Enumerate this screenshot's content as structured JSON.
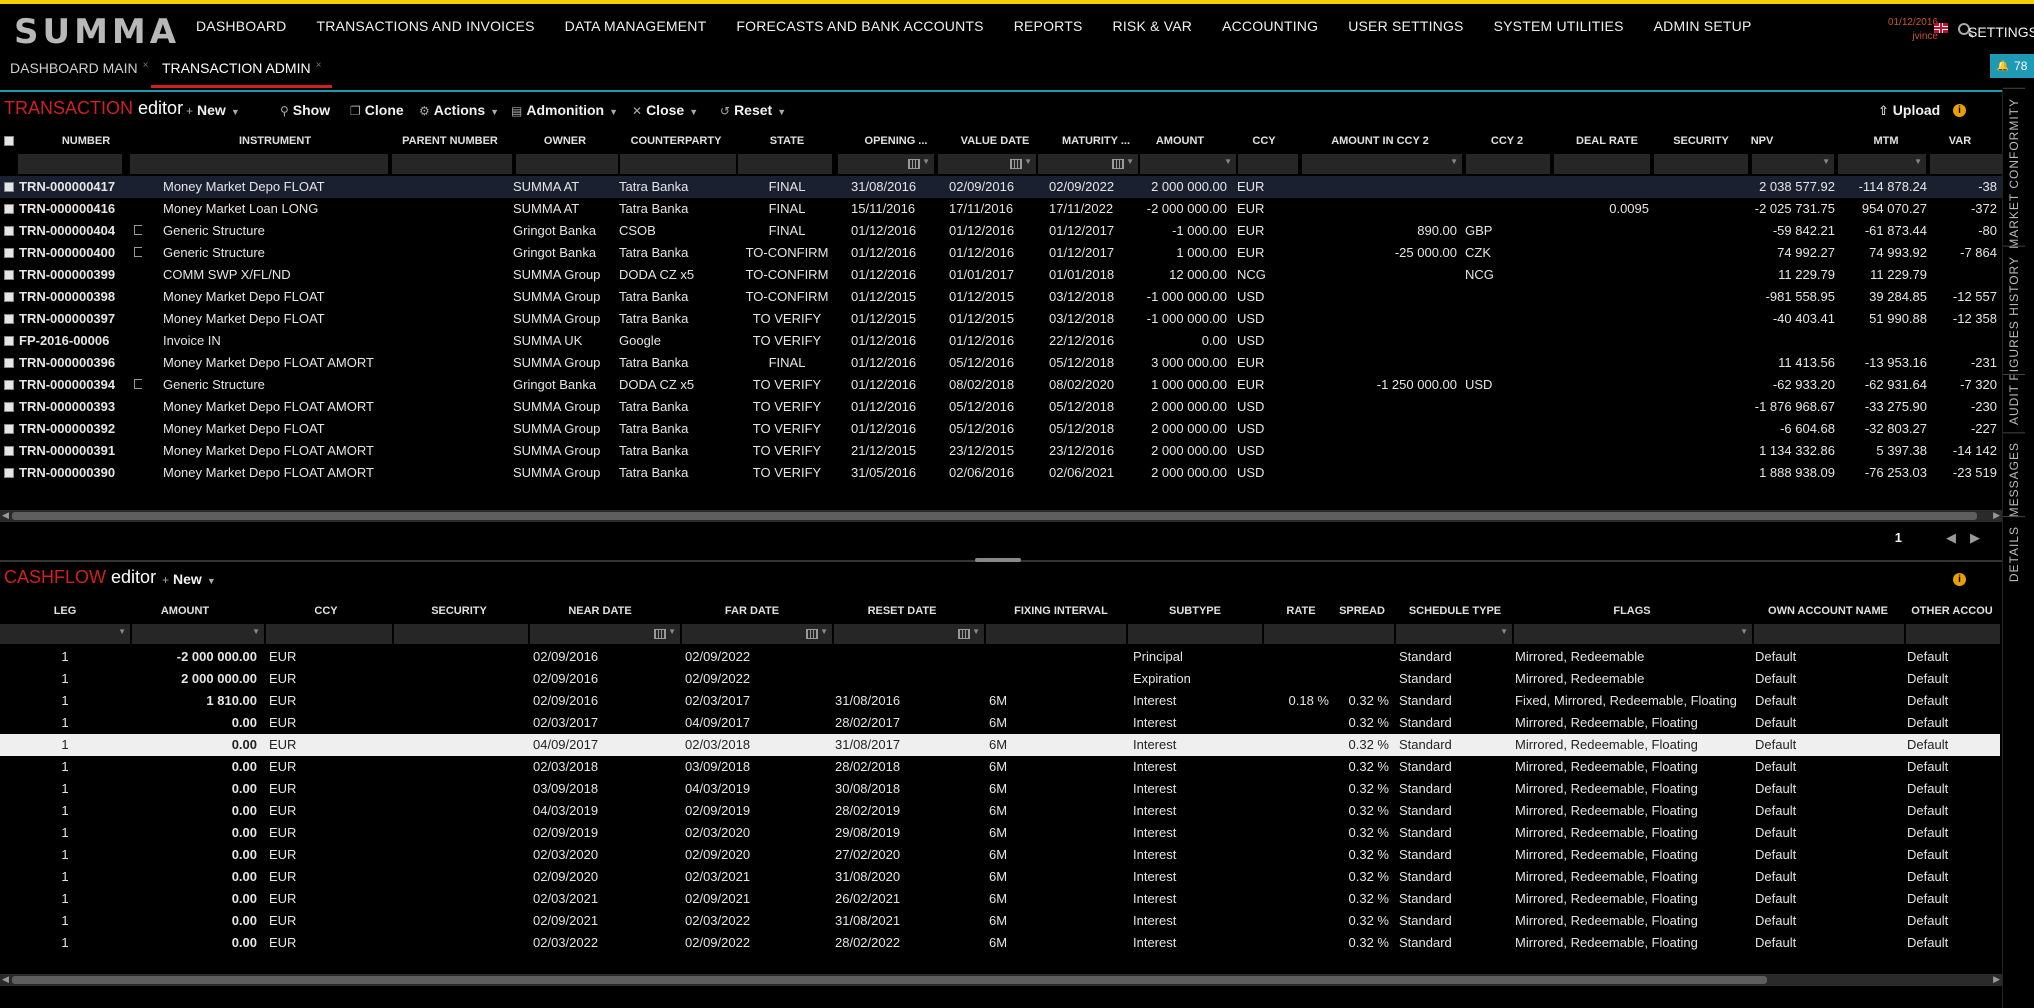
{
  "brand": "SUMMA",
  "nav": [
    "DASHBOARD",
    "TRANSACTIONS AND INVOICES",
    "DATA MANAGEMENT",
    "FORECASTS AND BANK ACCOUNTS",
    "REPORTS",
    "RISK & VAR",
    "ACCOUNTING",
    "USER SETTINGS",
    "SYSTEM UTILITIES",
    "ADMIN SETUP"
  ],
  "user": {
    "date": "01/12/2016",
    "name": "jvince"
  },
  "settings_label": "SETTINGS",
  "tabs": [
    {
      "label": "DASHBOARD MAIN"
    },
    {
      "label": "TRANSACTION ADMIN"
    }
  ],
  "notifications": "78",
  "transaction_editor": {
    "title_red": "TRANSACTION",
    "title_white": "editor",
    "toolbar": {
      "new": "New",
      "show": "Show",
      "clone": "Clone",
      "actions": "Actions",
      "admonition": "Admonition",
      "close": "Close",
      "reset": "Reset",
      "upload": "Upload"
    },
    "columns": [
      "NUMBER",
      "INSTRUMENT",
      "PARENT NUMBER",
      "OWNER",
      "COUNTERPARTY",
      "STATE",
      "OPENING ...",
      "VALUE DATE",
      "MATURITY ...",
      "AMOUNT",
      "CCY",
      "AMOUNT IN CCY 2",
      "CCY 2",
      "DEAL RATE",
      "SECURITY",
      "NPV",
      "MTM",
      "VAR"
    ],
    "rows": [
      {
        "number": "TRN-000000417",
        "instrument": "Money Market Depo FLOAT",
        "parent": "",
        "owner": "SUMMA AT",
        "counterparty": "Tatra Banka",
        "state": "FINAL",
        "opening": "31/08/2016",
        "value_date": "02/09/2016",
        "maturity": "02/09/2022",
        "amount": "2 000 000.00",
        "ccy": "EUR",
        "amount_ccy2": "",
        "ccy2": "",
        "deal_rate": "",
        "security": "",
        "npv": "2 038 577.92",
        "mtm": "-114 878.24",
        "var": "-38"
      },
      {
        "number": "TRN-000000416",
        "instrument": "Money Market Loan LONG",
        "parent": "",
        "owner": "SUMMA AT",
        "counterparty": "Tatra Banka",
        "state": "FINAL",
        "opening": "15/11/2016",
        "value_date": "17/11/2016",
        "maturity": "17/11/2022",
        "amount": "-2 000 000.00",
        "ccy": "EUR",
        "amount_ccy2": "",
        "ccy2": "",
        "deal_rate": "0.0095",
        "security": "",
        "npv": "-2 025 731.75",
        "mtm": "954 070.27",
        "var": "-372"
      },
      {
        "number": "TRN-000000404",
        "instrument": "Generic Structure",
        "parent": "",
        "owner": "Gringot Banka",
        "counterparty": "CSOB",
        "state": "FINAL",
        "opening": "01/12/2016",
        "value_date": "01/12/2016",
        "maturity": "01/12/2017",
        "amount": "-1 000.00",
        "ccy": "EUR",
        "amount_ccy2": "890.00",
        "ccy2": "GBP",
        "deal_rate": "",
        "security": "",
        "npv": "-59 842.21",
        "mtm": "-61 873.44",
        "var": "-80"
      },
      {
        "number": "TRN-000000400",
        "instrument": "Generic Structure",
        "parent": "",
        "owner": "Gringot Banka",
        "counterparty": "Tatra Banka",
        "state": "TO-CONFIRM",
        "opening": "01/12/2016",
        "value_date": "01/12/2016",
        "maturity": "01/12/2017",
        "amount": "1 000.00",
        "ccy": "EUR",
        "amount_ccy2": "-25 000.00",
        "ccy2": "CZK",
        "deal_rate": "",
        "security": "",
        "npv": "74 992.27",
        "mtm": "74 993.92",
        "var": "-7 864"
      },
      {
        "number": "TRN-000000399",
        "instrument": "COMM SWP X/FL/ND",
        "parent": "",
        "owner": "SUMMA Group",
        "counterparty": "DODA CZ x5",
        "state": "TO-CONFIRM",
        "opening": "01/12/2016",
        "value_date": "01/01/2017",
        "maturity": "01/01/2018",
        "amount": "12 000.00",
        "ccy": "NCG",
        "amount_ccy2": "",
        "ccy2": "NCG",
        "deal_rate": "",
        "security": "",
        "npv": "11 229.79",
        "mtm": "11 229.79",
        "var": ""
      },
      {
        "number": "TRN-000000398",
        "instrument": "Money Market Depo FLOAT",
        "parent": "",
        "owner": "SUMMA Group",
        "counterparty": "Tatra Banka",
        "state": "TO-CONFIRM",
        "opening": "01/12/2015",
        "value_date": "01/12/2015",
        "maturity": "03/12/2018",
        "amount": "-1 000 000.00",
        "ccy": "USD",
        "amount_ccy2": "",
        "ccy2": "",
        "deal_rate": "",
        "security": "",
        "npv": "-981 558.95",
        "mtm": "39 284.85",
        "var": "-12 557"
      },
      {
        "number": "TRN-000000397",
        "instrument": "Money Market Depo FLOAT",
        "parent": "",
        "owner": "SUMMA Group",
        "counterparty": "Tatra Banka",
        "state": "TO VERIFY",
        "opening": "01/12/2015",
        "value_date": "01/12/2015",
        "maturity": "03/12/2018",
        "amount": "-1 000 000.00",
        "ccy": "USD",
        "amount_ccy2": "",
        "ccy2": "",
        "deal_rate": "",
        "security": "",
        "npv": "-40 403.41",
        "mtm": "51 990.88",
        "var": "-12 358"
      },
      {
        "number": "FP-2016-00006",
        "instrument": "Invoice IN",
        "parent": "",
        "owner": "SUMMA UK",
        "counterparty": "Google",
        "state": "TO VERIFY",
        "opening": "01/12/2016",
        "value_date": "01/12/2016",
        "maturity": "22/12/2016",
        "amount": "0.00",
        "ccy": "USD",
        "amount_ccy2": "",
        "ccy2": "",
        "deal_rate": "",
        "security": "",
        "npv": "",
        "mtm": "",
        "var": ""
      },
      {
        "number": "TRN-000000396",
        "instrument": "Money Market Depo FLOAT AMORT",
        "parent": "",
        "owner": "SUMMA Group",
        "counterparty": "Tatra Banka",
        "state": "FINAL",
        "opening": "01/12/2016",
        "value_date": "05/12/2016",
        "maturity": "05/12/2018",
        "amount": "3 000 000.00",
        "ccy": "EUR",
        "amount_ccy2": "",
        "ccy2": "",
        "deal_rate": "",
        "security": "",
        "npv": "11 413.56",
        "mtm": "-13 953.16",
        "var": "-231"
      },
      {
        "number": "TRN-000000394",
        "instrument": "Generic Structure",
        "parent": "",
        "owner": "Gringot Banka",
        "counterparty": "DODA CZ x5",
        "state": "TO VERIFY",
        "opening": "01/12/2016",
        "value_date": "08/02/2018",
        "maturity": "08/02/2020",
        "amount": "1 000 000.00",
        "ccy": "EUR",
        "amount_ccy2": "-1 250 000.00",
        "ccy2": "USD",
        "deal_rate": "",
        "security": "",
        "npv": "-62 933.20",
        "mtm": "-62 931.64",
        "var": "-7 320"
      },
      {
        "number": "TRN-000000393",
        "instrument": "Money Market Depo FLOAT AMORT",
        "parent": "",
        "owner": "SUMMA Group",
        "counterparty": "Tatra Banka",
        "state": "TO VERIFY",
        "opening": "01/12/2016",
        "value_date": "05/12/2016",
        "maturity": "05/12/2018",
        "amount": "2 000 000.00",
        "ccy": "USD",
        "amount_ccy2": "",
        "ccy2": "",
        "deal_rate": "",
        "security": "",
        "npv": "-1 876 968.67",
        "mtm": "-33 275.90",
        "var": "-230"
      },
      {
        "number": "TRN-000000392",
        "instrument": "Money Market Depo FLOAT",
        "parent": "",
        "owner": "SUMMA Group",
        "counterparty": "Tatra Banka",
        "state": "TO VERIFY",
        "opening": "01/12/2016",
        "value_date": "05/12/2016",
        "maturity": "05/12/2018",
        "amount": "2 000 000.00",
        "ccy": "USD",
        "amount_ccy2": "",
        "ccy2": "",
        "deal_rate": "",
        "security": "",
        "npv": "-6 604.68",
        "mtm": "-32 803.27",
        "var": "-227"
      },
      {
        "number": "TRN-000000391",
        "instrument": "Money Market Depo FLOAT AMORT",
        "parent": "",
        "owner": "SUMMA Group",
        "counterparty": "Tatra Banka",
        "state": "TO VERIFY",
        "opening": "21/12/2015",
        "value_date": "23/12/2015",
        "maturity": "23/12/2016",
        "amount": "2 000 000.00",
        "ccy": "USD",
        "amount_ccy2": "",
        "ccy2": "",
        "deal_rate": "",
        "security": "",
        "npv": "1 134 332.86",
        "mtm": "5 397.38",
        "var": "-14 142"
      },
      {
        "number": "TRN-000000390",
        "instrument": "Money Market Depo FLOAT AMORT",
        "parent": "",
        "owner": "SUMMA Group",
        "counterparty": "Tatra Banka",
        "state": "TO VERIFY",
        "opening": "31/05/2016",
        "value_date": "02/06/2016",
        "maturity": "02/06/2021",
        "amount": "2 000 000.00",
        "ccy": "USD",
        "amount_ccy2": "",
        "ccy2": "",
        "deal_rate": "",
        "security": "",
        "npv": "1 888 938.09",
        "mtm": "-76 253.03",
        "var": "-23 519"
      }
    ],
    "page": "1"
  },
  "cashflow_editor": {
    "title_red": "CASHFLOW",
    "title_white": "editor",
    "toolbar": {
      "new": "New"
    },
    "columns": [
      "LEG",
      "AMOUNT",
      "CCY",
      "SECURITY",
      "NEAR DATE",
      "FAR DATE",
      "RESET DATE",
      "FIXING INTERVAL",
      "SUBTYPE",
      "RATE",
      "SPREAD",
      "SCHEDULE TYPE",
      "FLAGS",
      "OWN ACCOUNT NAME",
      "OTHER ACCOU"
    ],
    "rows": [
      {
        "leg": "1",
        "amount": "-2 000 000.00",
        "ccy": "EUR",
        "security": "",
        "near": "02/09/2016",
        "far": "02/09/2022",
        "reset": "",
        "fixing": "",
        "subtype": "Principal",
        "rate": "",
        "spread": "",
        "schedule": "Standard",
        "flags": "Mirrored, Redeemable",
        "own": "Default",
        "other": "Default"
      },
      {
        "leg": "1",
        "amount": "2 000 000.00",
        "ccy": "EUR",
        "security": "",
        "near": "02/09/2016",
        "far": "02/09/2022",
        "reset": "",
        "fixing": "",
        "subtype": "Expiration",
        "rate": "",
        "spread": "",
        "schedule": "Standard",
        "flags": "Mirrored, Redeemable",
        "own": "Default",
        "other": "Default"
      },
      {
        "leg": "1",
        "amount": "1 810.00",
        "ccy": "EUR",
        "security": "",
        "near": "02/09/2016",
        "far": "02/03/2017",
        "reset": "31/08/2016",
        "fixing": "6M",
        "subtype": "Interest",
        "rate": "0.18 %",
        "spread": "0.32 %",
        "schedule": "Standard",
        "flags": "Fixed, Mirrored, Redeemable, Floating",
        "own": "Default",
        "other": "Default"
      },
      {
        "leg": "1",
        "amount": "0.00",
        "ccy": "EUR",
        "security": "",
        "near": "02/03/2017",
        "far": "04/09/2017",
        "reset": "28/02/2017",
        "fixing": "6M",
        "subtype": "Interest",
        "rate": "",
        "spread": "0.32 %",
        "schedule": "Standard",
        "flags": "Mirrored, Redeemable, Floating",
        "own": "Default",
        "other": "Default"
      },
      {
        "leg": "1",
        "amount": "0.00",
        "ccy": "EUR",
        "security": "",
        "near": "04/09/2017",
        "far": "02/03/2018",
        "reset": "31/08/2017",
        "fixing": "6M",
        "subtype": "Interest",
        "rate": "",
        "spread": "0.32 %",
        "schedule": "Standard",
        "flags": "Mirrored, Redeemable, Floating",
        "own": "Default",
        "other": "Default"
      },
      {
        "leg": "1",
        "amount": "0.00",
        "ccy": "EUR",
        "security": "",
        "near": "02/03/2018",
        "far": "03/09/2018",
        "reset": "28/02/2018",
        "fixing": "6M",
        "subtype": "Interest",
        "rate": "",
        "spread": "0.32 %",
        "schedule": "Standard",
        "flags": "Mirrored, Redeemable, Floating",
        "own": "Default",
        "other": "Default"
      },
      {
        "leg": "1",
        "amount": "0.00",
        "ccy": "EUR",
        "security": "",
        "near": "03/09/2018",
        "far": "04/03/2019",
        "reset": "30/08/2018",
        "fixing": "6M",
        "subtype": "Interest",
        "rate": "",
        "spread": "0.32 %",
        "schedule": "Standard",
        "flags": "Mirrored, Redeemable, Floating",
        "own": "Default",
        "other": "Default"
      },
      {
        "leg": "1",
        "amount": "0.00",
        "ccy": "EUR",
        "security": "",
        "near": "04/03/2019",
        "far": "02/09/2019",
        "reset": "28/02/2019",
        "fixing": "6M",
        "subtype": "Interest",
        "rate": "",
        "spread": "0.32 %",
        "schedule": "Standard",
        "flags": "Mirrored, Redeemable, Floating",
        "own": "Default",
        "other": "Default"
      },
      {
        "leg": "1",
        "amount": "0.00",
        "ccy": "EUR",
        "security": "",
        "near": "02/09/2019",
        "far": "02/03/2020",
        "reset": "29/08/2019",
        "fixing": "6M",
        "subtype": "Interest",
        "rate": "",
        "spread": "0.32 %",
        "schedule": "Standard",
        "flags": "Mirrored, Redeemable, Floating",
        "own": "Default",
        "other": "Default"
      },
      {
        "leg": "1",
        "amount": "0.00",
        "ccy": "EUR",
        "security": "",
        "near": "02/03/2020",
        "far": "02/09/2020",
        "reset": "27/02/2020",
        "fixing": "6M",
        "subtype": "Interest",
        "rate": "",
        "spread": "0.32 %",
        "schedule": "Standard",
        "flags": "Mirrored, Redeemable, Floating",
        "own": "Default",
        "other": "Default"
      },
      {
        "leg": "1",
        "amount": "0.00",
        "ccy": "EUR",
        "security": "",
        "near": "02/09/2020",
        "far": "02/03/2021",
        "reset": "31/08/2020",
        "fixing": "6M",
        "subtype": "Interest",
        "rate": "",
        "spread": "0.32 %",
        "schedule": "Standard",
        "flags": "Mirrored, Redeemable, Floating",
        "own": "Default",
        "other": "Default"
      },
      {
        "leg": "1",
        "amount": "0.00",
        "ccy": "EUR",
        "security": "",
        "near": "02/03/2021",
        "far": "02/09/2021",
        "reset": "26/02/2021",
        "fixing": "6M",
        "subtype": "Interest",
        "rate": "",
        "spread": "0.32 %",
        "schedule": "Standard",
        "flags": "Mirrored, Redeemable, Floating",
        "own": "Default",
        "other": "Default"
      },
      {
        "leg": "1",
        "amount": "0.00",
        "ccy": "EUR",
        "security": "",
        "near": "02/09/2021",
        "far": "02/03/2022",
        "reset": "31/08/2021",
        "fixing": "6M",
        "subtype": "Interest",
        "rate": "",
        "spread": "0.32 %",
        "schedule": "Standard",
        "flags": "Mirrored, Redeemable, Floating",
        "own": "Default",
        "other": "Default"
      },
      {
        "leg": "1",
        "amount": "0.00",
        "ccy": "EUR",
        "security": "",
        "near": "02/03/2022",
        "far": "02/09/2022",
        "reset": "28/02/2022",
        "fixing": "6M",
        "subtype": "Interest",
        "rate": "",
        "spread": "0.32 %",
        "schedule": "Standard",
        "flags": "Mirrored, Redeemable, Floating",
        "own": "Default",
        "other": "Default"
      }
    ]
  },
  "side_tabs": [
    "MARKET CONFORMITY",
    "FIGURES HISTORY",
    "AUDIT",
    "MESSAGES",
    "DETAILS"
  ]
}
